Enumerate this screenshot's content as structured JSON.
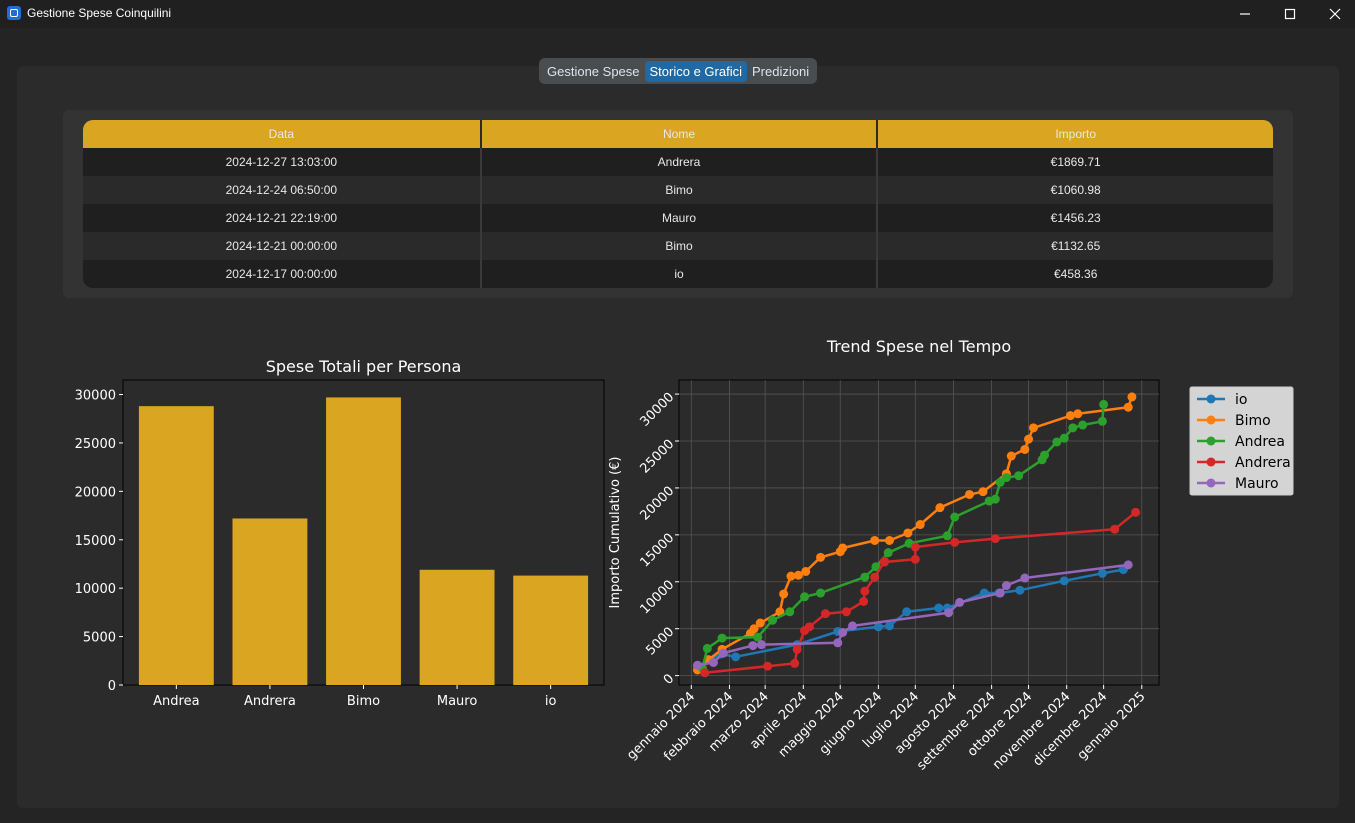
{
  "window": {
    "title": "Gestione Spese Coinquilini",
    "minimize_icon": "minimize-icon",
    "maximize_icon": "maximize-icon",
    "close_icon": "close-icon"
  },
  "tabs": [
    {
      "label": "Gestione Spese",
      "active": false
    },
    {
      "label": "Storico e Grafici",
      "active": true
    },
    {
      "label": "Predizioni",
      "active": false
    }
  ],
  "table": {
    "headers": [
      "Data",
      "Nome",
      "Importo"
    ],
    "rows": [
      [
        "2024-12-27 13:03:00",
        "Andrera",
        "€1869.71"
      ],
      [
        "2024-12-24 06:50:00",
        "Bimo",
        "€1060.98"
      ],
      [
        "2024-12-21 22:19:00",
        "Mauro",
        "€1456.23"
      ],
      [
        "2024-12-21 00:00:00",
        "Bimo",
        "€1132.65"
      ],
      [
        "2024-12-17 00:00:00",
        "io",
        "€458.36"
      ]
    ],
    "header_color": "#daa520"
  },
  "chart_data": [
    {
      "type": "bar",
      "title": "Spese Totali per Persona",
      "categories": [
        "Andrea",
        "Andrera",
        "Bimo",
        "Mauro",
        "io"
      ],
      "values": [
        28800,
        17200,
        29700,
        11900,
        11300
      ],
      "ylim": [
        0,
        31500
      ],
      "yticks": [
        0,
        5000,
        10000,
        15000,
        20000,
        25000,
        30000
      ],
      "bar_color": "#daa520",
      "xlabel": "",
      "ylabel": ""
    },
    {
      "type": "line",
      "title": "Trend Spese nel Tempo",
      "xlabel": "",
      "ylabel": "Importo Cumulativo (€)",
      "xticks": [
        "gennaio 2024",
        "febbraio 2024",
        "marzo 2024",
        "aprile 2024",
        "maggio 2024",
        "giugno 2024",
        "luglio 2024",
        "agosto 2024",
        "settembre 2024",
        "ottobre 2024",
        "novembre 2024",
        "dicembre 2024",
        "gennaio 2025"
      ],
      "yticks": [
        0,
        5000,
        10000,
        15000,
        20000,
        25000,
        30000
      ],
      "xlim": [
        "2023-12-22",
        "2025-01-15"
      ],
      "ylim": [
        -1000,
        31500
      ],
      "grid": true,
      "legend_position": "outside-right",
      "series": [
        {
          "name": "io",
          "color": "#1f77b4",
          "points": [
            [
              "2024-01-06",
              1000
            ],
            [
              "2024-01-25",
              2300
            ],
            [
              "2024-02-06",
              2000
            ],
            [
              "2024-03-27",
              3300
            ],
            [
              "2024-04-29",
              4700
            ],
            [
              "2024-06-01",
              5200
            ],
            [
              "2024-06-10",
              5300
            ],
            [
              "2024-06-24",
              6800
            ],
            [
              "2024-07-20",
              7200
            ],
            [
              "2024-07-27",
              7200
            ],
            [
              "2024-08-26",
              8800
            ],
            [
              "2024-09-07",
              8800
            ],
            [
              "2024-09-24",
              9100
            ],
            [
              "2024-10-30",
              10100
            ],
            [
              "2024-11-30",
              10900
            ],
            [
              "2024-12-17",
              11300
            ]
          ]
        },
        {
          "name": "Bimo",
          "color": "#ff7f0e",
          "points": [
            [
              "2024-01-06",
              600
            ],
            [
              "2024-01-15",
              1700
            ],
            [
              "2024-01-26",
              2800
            ],
            [
              "2024-02-18",
              4500
            ],
            [
              "2024-02-21",
              5000
            ],
            [
              "2024-02-26",
              5600
            ],
            [
              "2024-03-13",
              6800
            ],
            [
              "2024-03-16",
              8700
            ],
            [
              "2024-03-22",
              10600
            ],
            [
              "2024-03-28",
              10700
            ],
            [
              "2024-04-03",
              11100
            ],
            [
              "2024-04-15",
              12600
            ],
            [
              "2024-05-01",
              13200
            ],
            [
              "2024-05-03",
              13600
            ],
            [
              "2024-05-29",
              14400
            ],
            [
              "2024-06-10",
              14400
            ],
            [
              "2024-06-25",
              15200
            ],
            [
              "2024-07-05",
              16100
            ],
            [
              "2024-07-21",
              17900
            ],
            [
              "2024-08-14",
              19300
            ],
            [
              "2024-08-25",
              19600
            ],
            [
              "2024-09-13",
              21500
            ],
            [
              "2024-09-17",
              23400
            ],
            [
              "2024-09-28",
              24100
            ],
            [
              "2024-10-01",
              25200
            ],
            [
              "2024-10-05",
              26400
            ],
            [
              "2024-11-04",
              27700
            ],
            [
              "2024-11-10",
              27900
            ],
            [
              "2024-12-21",
              28600
            ],
            [
              "2024-12-24",
              29700
            ]
          ]
        },
        {
          "name": "Andrea",
          "color": "#2ca02c",
          "points": [
            [
              "2024-01-10",
              800
            ],
            [
              "2024-01-14",
              2900
            ],
            [
              "2024-01-26",
              4000
            ],
            [
              "2024-02-24",
              4100
            ],
            [
              "2024-03-07",
              5900
            ],
            [
              "2024-03-21",
              6800
            ],
            [
              "2024-04-02",
              8400
            ],
            [
              "2024-04-15",
              8800
            ],
            [
              "2024-05-21",
              10500
            ],
            [
              "2024-05-30",
              11600
            ],
            [
              "2024-06-09",
              13100
            ],
            [
              "2024-06-26",
              14100
            ],
            [
              "2024-07-27",
              14900
            ],
            [
              "2024-08-02",
              16900
            ],
            [
              "2024-08-30",
              18600
            ],
            [
              "2024-09-04",
              18800
            ],
            [
              "2024-09-08",
              20600
            ],
            [
              "2024-09-13",
              21100
            ],
            [
              "2024-09-23",
              21300
            ],
            [
              "2024-10-12",
              23000
            ],
            [
              "2024-10-14",
              23500
            ],
            [
              "2024-10-24",
              24900
            ],
            [
              "2024-10-30",
              25300
            ],
            [
              "2024-11-06",
              26400
            ],
            [
              "2024-11-14",
              26700
            ],
            [
              "2024-11-30",
              27100
            ],
            [
              "2024-12-01",
              28900
            ]
          ]
        },
        {
          "name": "Andrera",
          "color": "#d62728",
          "points": [
            [
              "2024-01-12",
              300
            ],
            [
              "2024-03-03",
              1000
            ],
            [
              "2024-03-25",
              1300
            ],
            [
              "2024-03-27",
              2800
            ],
            [
              "2024-04-02",
              4800
            ],
            [
              "2024-04-06",
              5200
            ],
            [
              "2024-04-19",
              6600
            ],
            [
              "2024-05-06",
              6800
            ],
            [
              "2024-05-20",
              7900
            ],
            [
              "2024-05-21",
              9000
            ],
            [
              "2024-05-29",
              10500
            ],
            [
              "2024-06-06",
              12200
            ],
            [
              "2024-06-06",
              12100
            ],
            [
              "2024-07-01",
              12400
            ],
            [
              "2024-07-01",
              13700
            ],
            [
              "2024-08-02",
              14200
            ],
            [
              "2024-09-04",
              14600
            ],
            [
              "2024-12-10",
              15600
            ],
            [
              "2024-12-27",
              17400
            ]
          ]
        },
        {
          "name": "Mauro",
          "color": "#9467bd",
          "points": [
            [
              "2024-01-06",
              1100
            ],
            [
              "2024-01-19",
              1400
            ],
            [
              "2024-01-27",
              2400
            ],
            [
              "2024-02-20",
              3200
            ],
            [
              "2024-02-27",
              3300
            ],
            [
              "2024-04-29",
              3500
            ],
            [
              "2024-05-03",
              4600
            ],
            [
              "2024-05-11",
              5300
            ],
            [
              "2024-07-28",
              6700
            ],
            [
              "2024-08-06",
              7800
            ],
            [
              "2024-09-08",
              8800
            ],
            [
              "2024-09-13",
              9600
            ],
            [
              "2024-09-28",
              10400
            ],
            [
              "2024-12-21",
              11800
            ]
          ]
        }
      ]
    }
  ]
}
